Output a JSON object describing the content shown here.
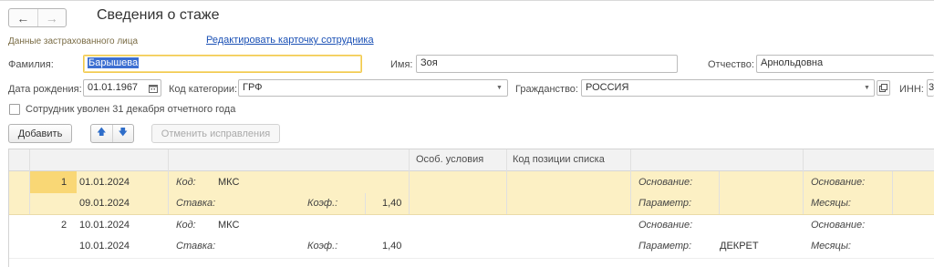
{
  "window": {
    "title": "Сведения о стаже",
    "back_icon": "←",
    "forward_icon": "→"
  },
  "section_label": "Данные застрахованного лица",
  "edit_link": "Редактировать карточку сотрудника",
  "fields": {
    "surname_label": "Фамилия:",
    "surname_value": "Барышева",
    "name_label": "Имя:",
    "name_value": "Зоя",
    "patronymic_label": "Отчество:",
    "patronymic_value": "Арнольдовна",
    "birthdate_label": "Дата рождения:",
    "birthdate_value": "01.01.1967",
    "category_label": "Код категории:",
    "category_value": "ГРФ",
    "citizenship_label": "Гражданство:",
    "citizenship_value": "РОССИЯ",
    "inn_label": "ИНН:",
    "inn_value": "3",
    "dismissed_label": "Сотрудник уволен 31 декабря отчетного года",
    "dismissed_checked": false
  },
  "toolbar": {
    "add_label": "Добавить",
    "up_icon": "🡅",
    "down_icon": "🡇",
    "cancel_corrections_label": "Отменить исправления"
  },
  "table": {
    "headers": {
      "special_conditions": "Особ. условия",
      "list_position_code": "Код позиции списка"
    },
    "rows": [
      {
        "num": "1",
        "date_from": "01.01.2024",
        "date_to": "09.01.2024",
        "code_label": "Код:",
        "code_value": "МКС",
        "rate_label": "Ставка:",
        "coef_label": "Коэф.:",
        "coef_value": "1,40",
        "basis_label": "Основание:",
        "basis_value": "",
        "param_label": "Параметр:",
        "param_value": "",
        "basis2_label": "Основание:",
        "months_label": "Месяцы:",
        "selected": true
      },
      {
        "num": "2",
        "date_from": "10.01.2024",
        "date_to": "10.01.2024",
        "code_label": "Код:",
        "code_value": "МКС",
        "rate_label": "Ставка:",
        "coef_label": "Коэф.:",
        "coef_value": "1,40",
        "basis_label": "Основание:",
        "basis_value": "",
        "param_label": "Параметр:",
        "param_value": "ДЕКРЕТ",
        "basis2_label": "Основание:",
        "months_label": "Месяцы:",
        "selected": false
      }
    ]
  }
}
